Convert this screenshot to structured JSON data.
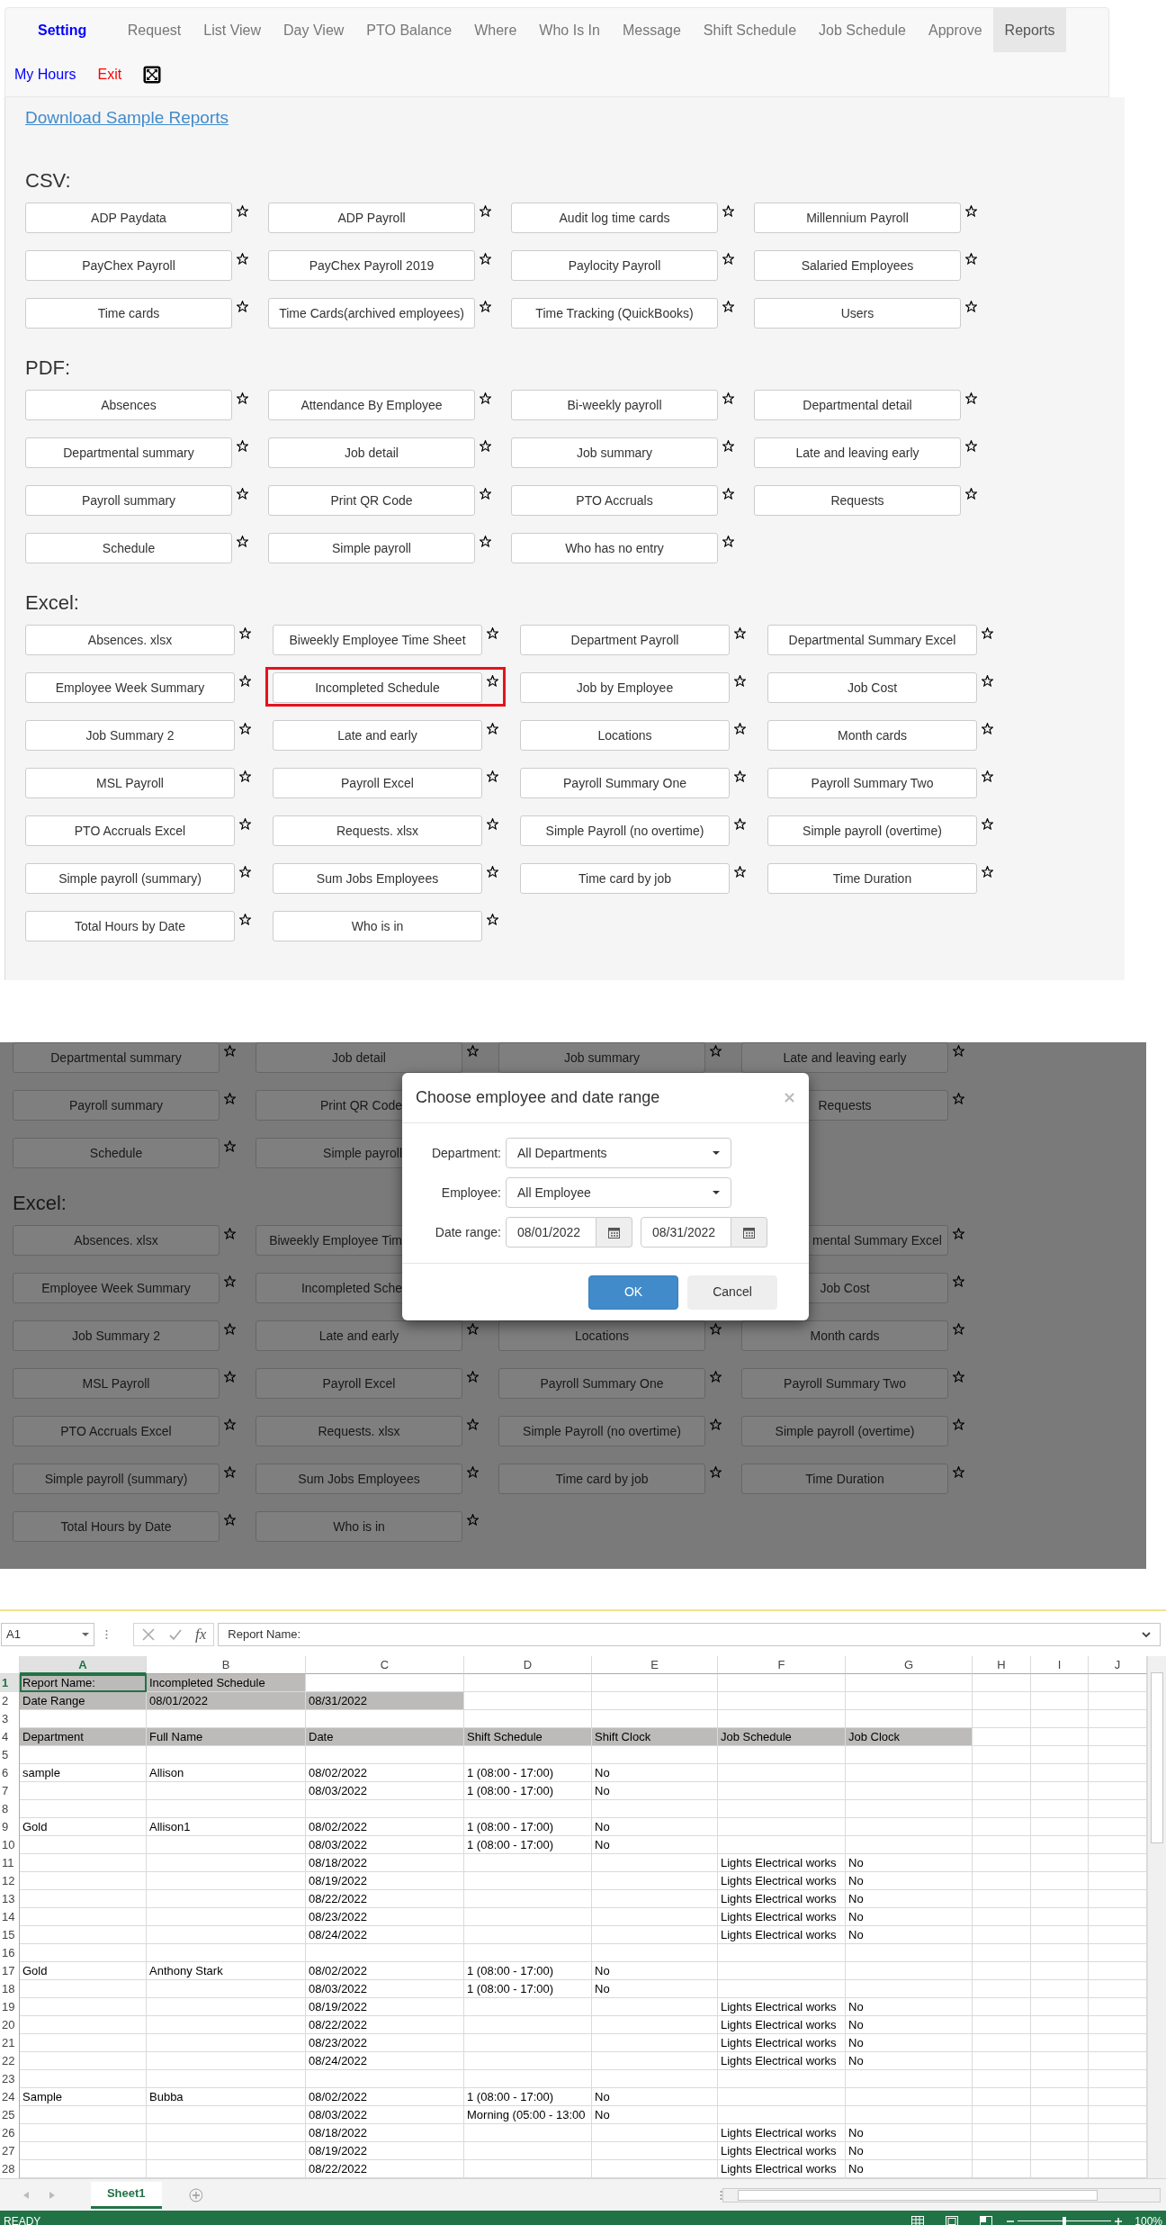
{
  "app_page": {
    "nav": {
      "brand": "Setting",
      "items": [
        {
          "label": "Request",
          "selected": false
        },
        {
          "label": "List View",
          "selected": false
        },
        {
          "label": "Day View",
          "selected": false
        },
        {
          "label": "PTO Balance",
          "selected": false
        },
        {
          "label": "Where",
          "selected": false
        },
        {
          "label": "Who Is In",
          "selected": false
        },
        {
          "label": "Message",
          "selected": false
        },
        {
          "label": "Shift Schedule",
          "selected": false
        },
        {
          "label": "Job Schedule",
          "selected": false
        },
        {
          "label": "Approve",
          "selected": false
        },
        {
          "label": "Reports",
          "selected": true
        }
      ],
      "links": [
        {
          "label": "My Hours",
          "color": "#0000ff"
        },
        {
          "label": "Exit",
          "color": "#ff0000"
        }
      ]
    },
    "download_link": "Download Sample Reports",
    "sections": [
      {
        "heading": "CSV:",
        "reports": [
          {
            "label": "ADP Paydata",
            "highlighted": false
          },
          {
            "label": "ADP Payroll",
            "highlighted": false
          },
          {
            "label": "Audit log time cards",
            "highlighted": false
          },
          {
            "label": "Millennium Payroll",
            "highlighted": false
          },
          {
            "label": "PayChex Payroll",
            "highlighted": false
          },
          {
            "label": "PayChex Payroll 2019",
            "highlighted": false
          },
          {
            "label": "Paylocity Payroll",
            "highlighted": false
          },
          {
            "label": "Salaried Employees",
            "highlighted": false
          },
          {
            "label": "Time cards",
            "highlighted": false
          },
          {
            "label": "Time Cards(archived employees)",
            "highlighted": false
          },
          {
            "label": "Time Tracking (QuickBooks)",
            "highlighted": false
          },
          {
            "label": "Users",
            "highlighted": false
          }
        ]
      },
      {
        "heading": "PDF:",
        "reports": [
          {
            "label": "Absences",
            "highlighted": false
          },
          {
            "label": "Attendance By Employee",
            "highlighted": false
          },
          {
            "label": "Bi-weekly payroll",
            "highlighted": false
          },
          {
            "label": "Departmental detail",
            "highlighted": false
          },
          {
            "label": "Departmental summary",
            "highlighted": false
          },
          {
            "label": "Job detail",
            "highlighted": false
          },
          {
            "label": "Job summary",
            "highlighted": false
          },
          {
            "label": "Late and leaving early",
            "highlighted": false
          },
          {
            "label": "Payroll summary",
            "highlighted": false
          },
          {
            "label": "Print QR Code",
            "highlighted": false
          },
          {
            "label": "PTO Accruals",
            "highlighted": false
          },
          {
            "label": "Requests",
            "highlighted": false
          },
          {
            "label": "Schedule",
            "highlighted": false
          },
          {
            "label": "Simple payroll",
            "highlighted": false
          },
          {
            "label": "Who has no entry",
            "highlighted": false
          }
        ]
      },
      {
        "heading": "Excel:",
        "reports": [
          {
            "label": "Absences. xlsx",
            "highlighted": false
          },
          {
            "label": "Biweekly Employee Time Sheet",
            "highlighted": false
          },
          {
            "label": "Department Payroll",
            "highlighted": false
          },
          {
            "label": "Departmental Summary Excel",
            "highlighted": false
          },
          {
            "label": "Employee Week Summary",
            "highlighted": false
          },
          {
            "label": "Incompleted Schedule",
            "highlighted": true
          },
          {
            "label": "Job by Employee",
            "highlighted": false
          },
          {
            "label": "Job Cost",
            "highlighted": false
          },
          {
            "label": "Job Summary 2",
            "highlighted": false
          },
          {
            "label": "Late and early",
            "highlighted": false
          },
          {
            "label": "Locations",
            "highlighted": false
          },
          {
            "label": "Month cards",
            "highlighted": false
          },
          {
            "label": "MSL Payroll",
            "highlighted": false
          },
          {
            "label": "Payroll Excel",
            "highlighted": false
          },
          {
            "label": "Payroll Summary One",
            "highlighted": false
          },
          {
            "label": "Payroll Summary Two",
            "highlighted": false
          },
          {
            "label": "PTO Accruals Excel",
            "highlighted": false
          },
          {
            "label": "Requests. xlsx",
            "highlighted": false
          },
          {
            "label": "Simple Payroll (no overtime)",
            "highlighted": false
          },
          {
            "label": "Simple payroll (overtime)",
            "highlighted": false
          },
          {
            "label": "Simple payroll (summary)",
            "highlighted": false
          },
          {
            "label": "Sum Jobs Employees",
            "highlighted": false
          },
          {
            "label": "Time card by job",
            "highlighted": false
          },
          {
            "label": "Time Duration",
            "highlighted": false
          },
          {
            "label": "Total Hours by Date",
            "highlighted": false
          },
          {
            "label": "Who is in",
            "highlighted": false
          }
        ]
      }
    ]
  },
  "dialog_screen": {
    "rows": [
      {
        "kind": "buttons",
        "cells": [
          {
            "label": "Departmental summary",
            "kind": "whole"
          },
          {
            "label": "Job detail",
            "kind": "whole"
          },
          {
            "label": "Job summary",
            "kind": "whole"
          },
          {
            "label": "Late and leaving early",
            "kind": "whole"
          }
        ]
      },
      {
        "kind": "buttons",
        "cells": [
          {
            "label": "Payroll summary",
            "kind": "whole"
          },
          {
            "label": "Print QR Code",
            "kind": "cut_right"
          },
          null,
          {
            "label": "Requests",
            "kind": "whole"
          }
        ]
      },
      {
        "kind": "buttons",
        "cells": [
          {
            "label": "Schedule",
            "kind": "whole"
          },
          {
            "label": "Simple payroll",
            "kind": "cut_right"
          },
          null,
          null
        ]
      },
      {
        "kind": "heading",
        "text": "Excel:"
      },
      {
        "kind": "buttons",
        "cells": [
          {
            "label": "Absences. xlsx",
            "kind": "whole"
          },
          {
            "label": "Biweekly Employee Tim",
            "kind": "cut_right"
          },
          null,
          {
            "label": "mental Summary Excel",
            "kind": "cut_left"
          }
        ]
      },
      {
        "kind": "buttons",
        "cells": [
          {
            "label": "Employee Week Summary",
            "kind": "whole"
          },
          {
            "label": "Incompleted Sche",
            "kind": "cut_right"
          },
          null,
          {
            "label": "Job Cost",
            "kind": "whole"
          }
        ]
      },
      {
        "kind": "buttons",
        "cells": [
          {
            "label": "Job Summary 2",
            "kind": "whole"
          },
          {
            "label": "Late and early",
            "kind": "whole"
          },
          {
            "label": "Locations",
            "kind": "whole"
          },
          {
            "label": "Month cards",
            "kind": "whole"
          }
        ]
      },
      {
        "kind": "buttons",
        "cells": [
          {
            "label": "MSL Payroll",
            "kind": "whole"
          },
          {
            "label": "Payroll Excel",
            "kind": "whole"
          },
          {
            "label": "Payroll Summary One",
            "kind": "whole"
          },
          {
            "label": "Payroll Summary Two",
            "kind": "whole"
          }
        ]
      },
      {
        "kind": "buttons",
        "cells": [
          {
            "label": "PTO Accruals Excel",
            "kind": "whole"
          },
          {
            "label": "Requests. xlsx",
            "kind": "whole"
          },
          {
            "label": "Simple Payroll (no overtime)",
            "kind": "whole"
          },
          {
            "label": "Simple payroll (overtime)",
            "kind": "whole"
          }
        ]
      },
      {
        "kind": "buttons",
        "cells": [
          {
            "label": "Simple payroll (summary)",
            "kind": "whole"
          },
          {
            "label": "Sum Jobs Employees",
            "kind": "whole"
          },
          {
            "label": "Time card by job",
            "kind": "whole"
          },
          {
            "label": "Time Duration",
            "kind": "whole"
          }
        ]
      },
      {
        "kind": "buttons",
        "cells": [
          {
            "label": "Total Hours by Date",
            "kind": "whole"
          },
          {
            "label": "Who is in",
            "kind": "whole"
          }
        ]
      }
    ],
    "dialog": {
      "title": "Choose employee and date range",
      "fields": [
        {
          "label": "Department:",
          "kind": "select",
          "value": "All Departments"
        },
        {
          "label": "Employee:",
          "kind": "select",
          "value": "All Employee"
        },
        {
          "label": "Date range:",
          "kind": "dates",
          "values": [
            "08/01/2022",
            "08/31/2022"
          ]
        }
      ],
      "buttons": [
        {
          "label": "OK",
          "kind": "primary"
        },
        {
          "label": "Cancel",
          "kind": "secondary"
        }
      ]
    }
  },
  "spreadsheet": {
    "name_box": "A1",
    "function_label": "fx",
    "formula": "Report Name:",
    "columns": [
      {
        "label": "A",
        "selected": true
      },
      {
        "label": "B",
        "selected": false
      },
      {
        "label": "C",
        "selected": false
      },
      {
        "label": "D",
        "selected": false
      },
      {
        "label": "E",
        "selected": false
      },
      {
        "label": "F",
        "selected": false
      },
      {
        "label": "G",
        "selected": false
      },
      {
        "label": "H",
        "selected": false
      },
      {
        "label": "I",
        "selected": false
      },
      {
        "label": "J",
        "selected": false
      }
    ],
    "rows": [
      {
        "number": "1",
        "selected": true,
        "cells": [
          {
            "text": "Report Name:",
            "shaded": true,
            "selected": true
          },
          {
            "text": "Incompleted Schedule",
            "shaded": true,
            "selected": false
          }
        ]
      },
      {
        "number": "2",
        "selected": false,
        "cells": [
          {
            "text": "Date Range",
            "shaded": true,
            "selected": false
          },
          {
            "text": "08/01/2022",
            "shaded": true,
            "selected": false
          },
          {
            "text": "08/31/2022",
            "shaded": true,
            "selected": false
          }
        ]
      },
      {
        "number": "3",
        "selected": false
      },
      {
        "number": "4",
        "selected": false,
        "cells": [
          {
            "text": "Department",
            "shaded": true,
            "selected": false
          },
          {
            "text": "Full Name",
            "shaded": true,
            "selected": false
          },
          {
            "text": "Date",
            "shaded": true,
            "selected": false
          },
          {
            "text": "Shift Schedule",
            "shaded": true,
            "selected": false
          },
          {
            "text": "Shift Clock",
            "shaded": true,
            "selected": false
          },
          {
            "text": "Job Schedule",
            "shaded": true,
            "selected": false
          },
          {
            "text": "Job Clock",
            "shaded": true,
            "selected": false
          }
        ]
      },
      {
        "number": "5",
        "selected": false
      },
      {
        "number": "6",
        "selected": false,
        "cells": [
          {
            "text": "sample",
            "shaded": false,
            "selected": false
          },
          {
            "text": "Allison",
            "shaded": false,
            "selected": false
          },
          {
            "text": "08/02/2022",
            "shaded": false,
            "selected": false
          },
          {
            "text": "1 (08:00 - 17:00)",
            "shaded": false,
            "selected": false
          },
          {
            "text": "No",
            "shaded": false,
            "selected": false
          }
        ]
      },
      {
        "number": "7",
        "selected": false,
        "cells": [
          null,
          null,
          {
            "text": "08/03/2022",
            "shaded": false,
            "selected": false
          },
          {
            "text": "1 (08:00 - 17:00)",
            "shaded": false,
            "selected": false
          },
          {
            "text": "No",
            "shaded": false,
            "selected": false
          }
        ]
      },
      {
        "number": "8",
        "selected": false
      },
      {
        "number": "9",
        "selected": false,
        "cells": [
          {
            "text": "Gold",
            "shaded": false,
            "selected": false
          },
          {
            "text": "Allison1",
            "shaded": false,
            "selected": false
          },
          {
            "text": "08/02/2022",
            "shaded": false,
            "selected": false
          },
          {
            "text": "1 (08:00 - 17:00)",
            "shaded": false,
            "selected": false
          },
          {
            "text": "No",
            "shaded": false,
            "selected": false
          }
        ]
      },
      {
        "number": "10",
        "selected": false,
        "cells": [
          null,
          null,
          {
            "text": "08/03/2022",
            "shaded": false,
            "selected": false
          },
          {
            "text": "1 (08:00 - 17:00)",
            "shaded": false,
            "selected": false
          },
          {
            "text": "No",
            "shaded": false,
            "selected": false
          }
        ]
      },
      {
        "number": "11",
        "selected": false,
        "cells": [
          null,
          null,
          {
            "text": "08/18/2022",
            "shaded": false,
            "selected": false
          },
          null,
          null,
          {
            "text": "Lights Electrical works",
            "shaded": false,
            "selected": false
          },
          {
            "text": "No",
            "shaded": false,
            "selected": false
          }
        ]
      },
      {
        "number": "12",
        "selected": false,
        "cells": [
          null,
          null,
          {
            "text": "08/19/2022",
            "shaded": false,
            "selected": false
          },
          null,
          null,
          {
            "text": "Lights Electrical works",
            "shaded": false,
            "selected": false
          },
          {
            "text": "No",
            "shaded": false,
            "selected": false
          }
        ]
      },
      {
        "number": "13",
        "selected": false,
        "cells": [
          null,
          null,
          {
            "text": "08/22/2022",
            "shaded": false,
            "selected": false
          },
          null,
          null,
          {
            "text": "Lights Electrical works",
            "shaded": false,
            "selected": false
          },
          {
            "text": "No",
            "shaded": false,
            "selected": false
          }
        ]
      },
      {
        "number": "14",
        "selected": false,
        "cells": [
          null,
          null,
          {
            "text": "08/23/2022",
            "shaded": false,
            "selected": false
          },
          null,
          null,
          {
            "text": "Lights Electrical works",
            "shaded": false,
            "selected": false
          },
          {
            "text": "No",
            "shaded": false,
            "selected": false
          }
        ]
      },
      {
        "number": "15",
        "selected": false,
        "cells": [
          null,
          null,
          {
            "text": "08/24/2022",
            "shaded": false,
            "selected": false
          },
          null,
          null,
          {
            "text": "Lights Electrical works",
            "shaded": false,
            "selected": false
          },
          {
            "text": "No",
            "shaded": false,
            "selected": false
          }
        ]
      },
      {
        "number": "16",
        "selected": false
      },
      {
        "number": "17",
        "selected": false,
        "cells": [
          {
            "text": "Gold",
            "shaded": false,
            "selected": false
          },
          {
            "text": "Anthony Stark",
            "shaded": false,
            "selected": false
          },
          {
            "text": "08/02/2022",
            "shaded": false,
            "selected": false
          },
          {
            "text": "1 (08:00 - 17:00)",
            "shaded": false,
            "selected": false
          },
          {
            "text": "No",
            "shaded": false,
            "selected": false
          }
        ]
      },
      {
        "number": "18",
        "selected": false,
        "cells": [
          null,
          null,
          {
            "text": "08/03/2022",
            "shaded": false,
            "selected": false
          },
          {
            "text": "1 (08:00 - 17:00)",
            "shaded": false,
            "selected": false
          },
          {
            "text": "No",
            "shaded": false,
            "selected": false
          }
        ]
      },
      {
        "number": "19",
        "selected": false,
        "cells": [
          null,
          null,
          {
            "text": "08/19/2022",
            "shaded": false,
            "selected": false
          },
          null,
          null,
          {
            "text": "Lights Electrical works",
            "shaded": false,
            "selected": false
          },
          {
            "text": "No",
            "shaded": false,
            "selected": false
          }
        ]
      },
      {
        "number": "20",
        "selected": false,
        "cells": [
          null,
          null,
          {
            "text": "08/22/2022",
            "shaded": false,
            "selected": false
          },
          null,
          null,
          {
            "text": "Lights Electrical works",
            "shaded": false,
            "selected": false
          },
          {
            "text": "No",
            "shaded": false,
            "selected": false
          }
        ]
      },
      {
        "number": "21",
        "selected": false,
        "cells": [
          null,
          null,
          {
            "text": "08/23/2022",
            "shaded": false,
            "selected": false
          },
          null,
          null,
          {
            "text": "Lights Electrical works",
            "shaded": false,
            "selected": false
          },
          {
            "text": "No",
            "shaded": false,
            "selected": false
          }
        ]
      },
      {
        "number": "22",
        "selected": false,
        "cells": [
          null,
          null,
          {
            "text": "08/24/2022",
            "shaded": false,
            "selected": false
          },
          null,
          null,
          {
            "text": "Lights Electrical works",
            "shaded": false,
            "selected": false
          },
          {
            "text": "No",
            "shaded": false,
            "selected": false
          }
        ]
      },
      {
        "number": "23",
        "selected": false
      },
      {
        "number": "24",
        "selected": false,
        "cells": [
          {
            "text": "Sample",
            "shaded": false,
            "selected": false
          },
          {
            "text": "Bubba",
            "shaded": false,
            "selected": false
          },
          {
            "text": "08/02/2022",
            "shaded": false,
            "selected": false
          },
          {
            "text": "1 (08:00 - 17:00)",
            "shaded": false,
            "selected": false
          },
          {
            "text": "No",
            "shaded": false,
            "selected": false
          }
        ]
      },
      {
        "number": "25",
        "selected": false,
        "cells": [
          null,
          null,
          {
            "text": "08/03/2022",
            "shaded": false,
            "selected": false
          },
          {
            "text": "Morning (05:00 - 13:00",
            "shaded": false,
            "selected": false
          },
          {
            "text": "No",
            "shaded": false,
            "selected": false
          }
        ]
      },
      {
        "number": "26",
        "selected": false,
        "cells": [
          null,
          null,
          {
            "text": "08/18/2022",
            "shaded": false,
            "selected": false
          },
          null,
          null,
          {
            "text": "Lights Electrical works",
            "shaded": false,
            "selected": false
          },
          {
            "text": "No",
            "shaded": false,
            "selected": false
          }
        ]
      },
      {
        "number": "27",
        "selected": false,
        "cells": [
          null,
          null,
          {
            "text": "08/19/2022",
            "shaded": false,
            "selected": false
          },
          null,
          null,
          {
            "text": "Lights Electrical works",
            "shaded": false,
            "selected": false
          },
          {
            "text": "No",
            "shaded": false,
            "selected": false
          }
        ]
      },
      {
        "number": "28",
        "selected": false,
        "cells": [
          null,
          null,
          {
            "text": "08/22/2022",
            "shaded": false,
            "selected": false
          },
          null,
          null,
          {
            "text": "Lights Electrical works",
            "shaded": false,
            "selected": false
          },
          {
            "text": "No",
            "shaded": false,
            "selected": false
          }
        ]
      }
    ],
    "sheets": [
      {
        "label": "Sheet1",
        "selected": true
      }
    ],
    "status": "READY",
    "zoom": {
      "level": 0.5,
      "reading": "100%"
    }
  }
}
